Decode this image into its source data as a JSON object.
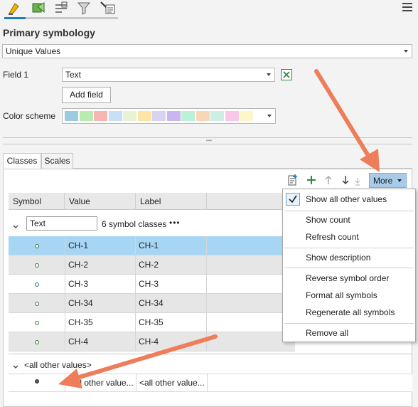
{
  "toolbar": {
    "icons": [
      "symbology-icon",
      "vary-by-attribute-icon",
      "labels-icon",
      "filter-icon",
      "advanced-settings-icon"
    ],
    "menu_icon": "hamburger-menu-icon"
  },
  "header": {
    "title": "Primary symbology"
  },
  "symbology_type": {
    "value": "Unique Values"
  },
  "field1": {
    "label": "Field 1",
    "value": "Text",
    "add_field_label": "Add field"
  },
  "color_scheme": {
    "label": "Color scheme",
    "swatches": [
      "#9ecae1",
      "#b9ebb0",
      "#f7b6b2",
      "#c6e0f5",
      "#e8f3d6",
      "#fde5a6",
      "#d9d3f2",
      "#c9b6f0",
      "#baf2d8",
      "#fad6b8",
      "#cdeee3",
      "#f9c8e8",
      "#fcf6c8"
    ]
  },
  "tabs": [
    {
      "label": "Classes"
    },
    {
      "label": "Scales"
    }
  ],
  "classes_toolbar": {
    "more_label": "More"
  },
  "grid": {
    "columns": [
      "Symbol",
      "Value",
      "Label"
    ],
    "group": {
      "field": "Text",
      "summary": "6 symbol classes",
      "more": "•••"
    },
    "rows": [
      {
        "value": "CH-1",
        "label": "CH-1"
      },
      {
        "value": "CH-2",
        "label": "CH-2"
      },
      {
        "value": "CH-3",
        "label": "CH-3"
      },
      {
        "value": "CH-34",
        "label": "CH-34"
      },
      {
        "value": "CH-35",
        "label": "CH-35"
      },
      {
        "value": "CH-4",
        "label": "CH-4"
      }
    ],
    "other_group": {
      "title": "<all other values>",
      "value": "<all other value...",
      "label": "<all other value..."
    }
  },
  "more_menu": {
    "show_all": "Show all other values",
    "show_count": "Show count",
    "refresh_count": "Refresh count",
    "show_description": "Show description",
    "reverse_order": "Reverse symbol order",
    "format_all": "Format all symbols",
    "regenerate_all": "Regenerate all symbols",
    "remove_all": "Remove all"
  },
  "colors": {
    "accent": "#1d7ec2",
    "selection": "#a7d6f5",
    "annotation_arrow": "#ee7d5a"
  }
}
